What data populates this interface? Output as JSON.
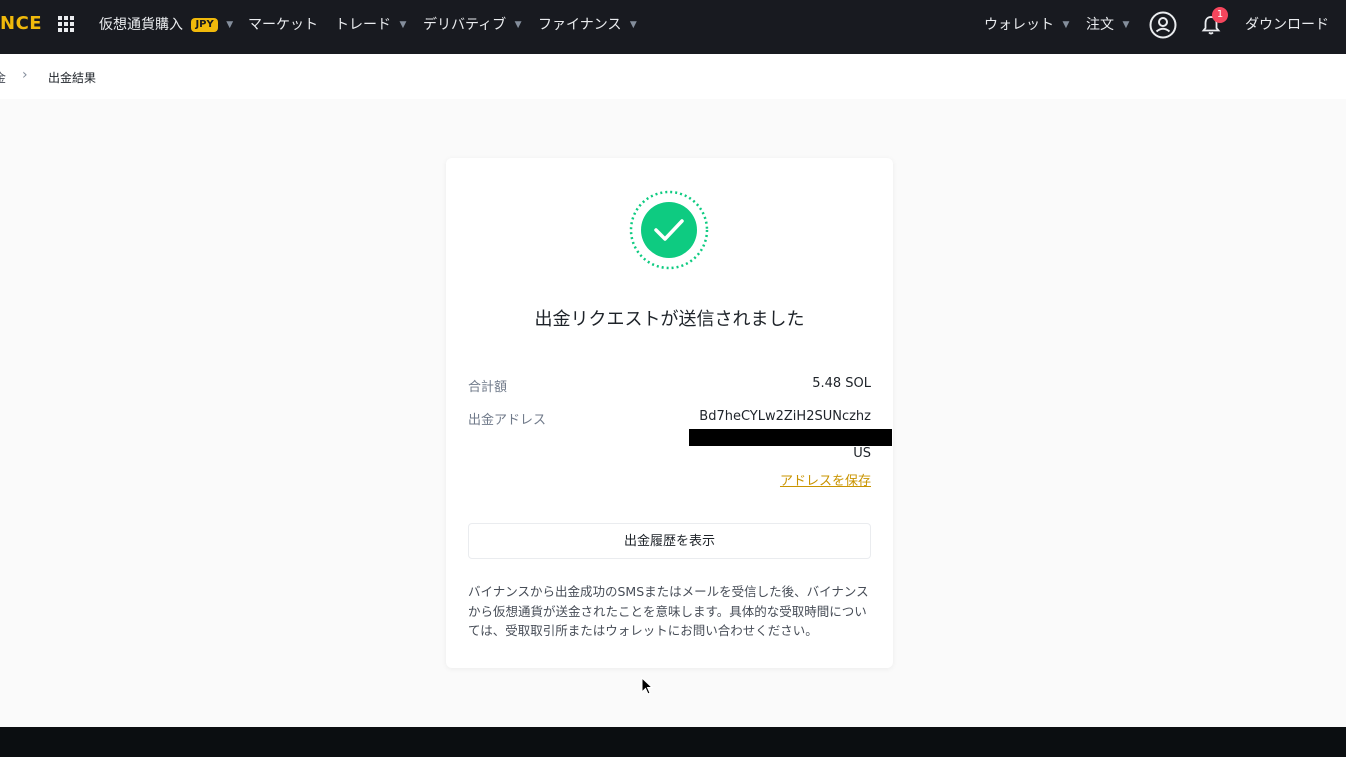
{
  "nav": {
    "logo": "NCE",
    "items": [
      {
        "label": "仮想通貨購入",
        "badge": "JPY"
      },
      {
        "label": "マーケット"
      },
      {
        "label": "トレード"
      },
      {
        "label": "デリバティブ"
      },
      {
        "label": "ファイナンス"
      }
    ],
    "right": {
      "wallet": "ウォレット",
      "orders": "注文",
      "notification_count": "1",
      "download": "ダウンロード"
    }
  },
  "breadcrumb": {
    "prev": "金",
    "separator": "›",
    "current": "出金結果"
  },
  "result": {
    "title": "出金リクエストが送信されました",
    "total_label": "合計額",
    "total_value": "5.48 SOL",
    "address_label": "出金アドレス",
    "address_line1": "Bd7heCYLw2ZiH2SUNczhz",
    "address_line3": "US",
    "save_address": "アドレスを保存",
    "history_button": "出金履歴を表示",
    "note": "バイナンスから出金成功のSMSまたはメールを受信した後、バイナンスから仮想通貨が送金されたことを意味します。具体的な受取時間については、受取取引所またはウォレットにお問い合わせください。"
  },
  "colors": {
    "nav_bg": "#181a20",
    "brand": "#f0b90b",
    "success": "#0ecb81",
    "link": "#c99400",
    "notif": "#f6465d"
  }
}
